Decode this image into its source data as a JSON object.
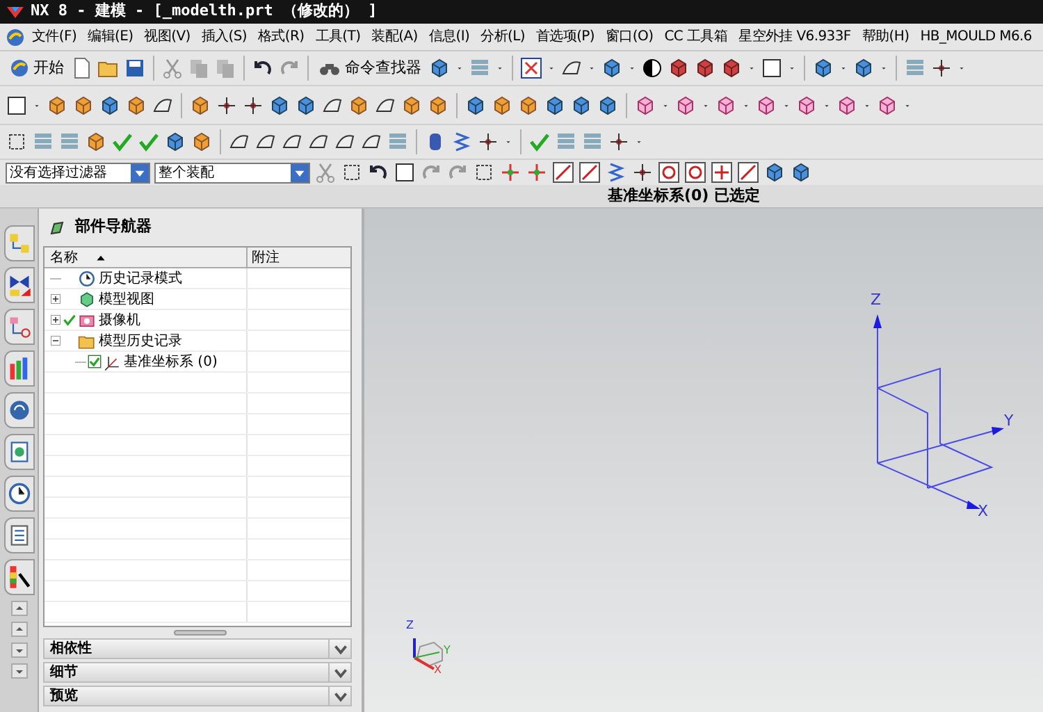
{
  "window": {
    "title": "NX 8 - 建模 - [_modelth.prt （修改的） ]"
  },
  "menu": [
    "文件(F)",
    "编辑(E)",
    "视图(V)",
    "插入(S)",
    "格式(R)",
    "工具(T)",
    "装配(A)",
    "信息(I)",
    "分析(L)",
    "首选项(P)",
    "窗口(O)",
    "CC 工具箱",
    "星空外挂 V6.933F",
    "帮助(H)",
    "HB_MOULD M6.6"
  ],
  "toolbar": {
    "start_button": "开始",
    "command_finder": "命令查找器"
  },
  "selection_bar": {
    "filter": "没有选择过滤器",
    "scope": "整个装配"
  },
  "status": "基准坐标系(0) 已选定",
  "part_navigator": {
    "title": "部件导航器",
    "columns": [
      "名称",
      "附注"
    ],
    "tree": [
      {
        "label": "历史记录模式",
        "kind": "clock",
        "checked": false
      },
      {
        "label": "模型视图",
        "kind": "views",
        "checked": false,
        "expanded": false
      },
      {
        "label": "摄像机",
        "kind": "camera",
        "checked": true,
        "expanded": false
      },
      {
        "label": "模型历史记录",
        "kind": "folder",
        "checked": false,
        "expanded": true,
        "children": [
          {
            "label": "基准坐标系 (0)",
            "kind": "csys",
            "checked": true
          }
        ]
      }
    ]
  },
  "panels": [
    {
      "label": "相依性",
      "expanded": false
    },
    {
      "label": "细节",
      "expanded": false
    },
    {
      "label": "预览",
      "expanded": false
    }
  ],
  "viewport": {
    "axis_labels": [
      "Z",
      "Y",
      "X"
    ],
    "triad_labels": [
      "Z",
      "Y",
      "X"
    ]
  }
}
